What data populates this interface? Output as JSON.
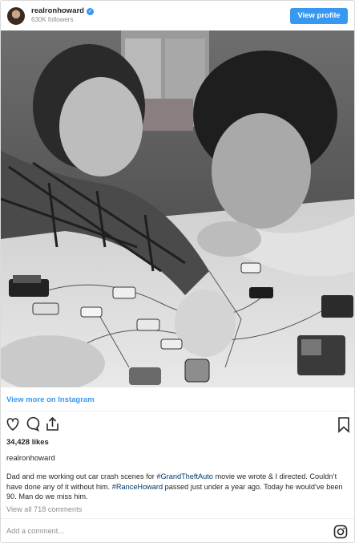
{
  "header": {
    "username": "realronhoward",
    "followers": "630K followers",
    "view_profile": "View profile"
  },
  "post": {
    "view_more": "View more on Instagram",
    "likes": "34,428 likes",
    "caption_user": "realronhoward",
    "caption_parts": [
      "Dad and me working out car crash scenes for ",
      "#GrandTheftAuto",
      " movie we wrote & I directed. Couldn’t have done any of it without him. ",
      "#RanceHoward",
      " passed just under a year ago. Today he would’ve been 90. Man do we miss him."
    ],
    "view_comments": "View all 718 comments",
    "add_comment_placeholder": "Add a comment..."
  },
  "icons": [
    "heart-icon",
    "comment-icon",
    "share-icon",
    "bookmark-icon",
    "instagram-icon",
    "verified-icon"
  ],
  "colors": {
    "accent": "#3897f0",
    "hashtag": "#003569",
    "muted": "#8e8e8e"
  }
}
